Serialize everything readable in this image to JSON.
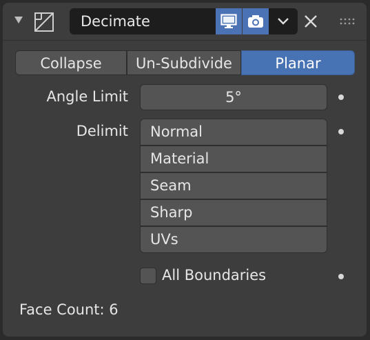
{
  "modifier": {
    "name": "Decimate",
    "icon": "decimate-modifier-icon",
    "viewport_icon": "monitor-icon",
    "render_icon": "camera-icon",
    "menu_icon": "chevron-down-icon",
    "close_icon": "close-icon",
    "drag_icon": "drag-handle-icon",
    "accent_color": "#4772b3"
  },
  "mode_tabs": [
    {
      "label": "Collapse",
      "active": false
    },
    {
      "label": "Un-Subdivide",
      "active": false
    },
    {
      "label": "Planar",
      "active": true
    }
  ],
  "angle_limit": {
    "label": "Angle Limit",
    "value": "5°"
  },
  "delimit": {
    "label": "Delimit",
    "options": [
      "Normal",
      "Material",
      "Seam",
      "Sharp",
      "UVs"
    ]
  },
  "all_boundaries": {
    "label": "All Boundaries",
    "checked": false
  },
  "face_count": "Face Count: 6"
}
